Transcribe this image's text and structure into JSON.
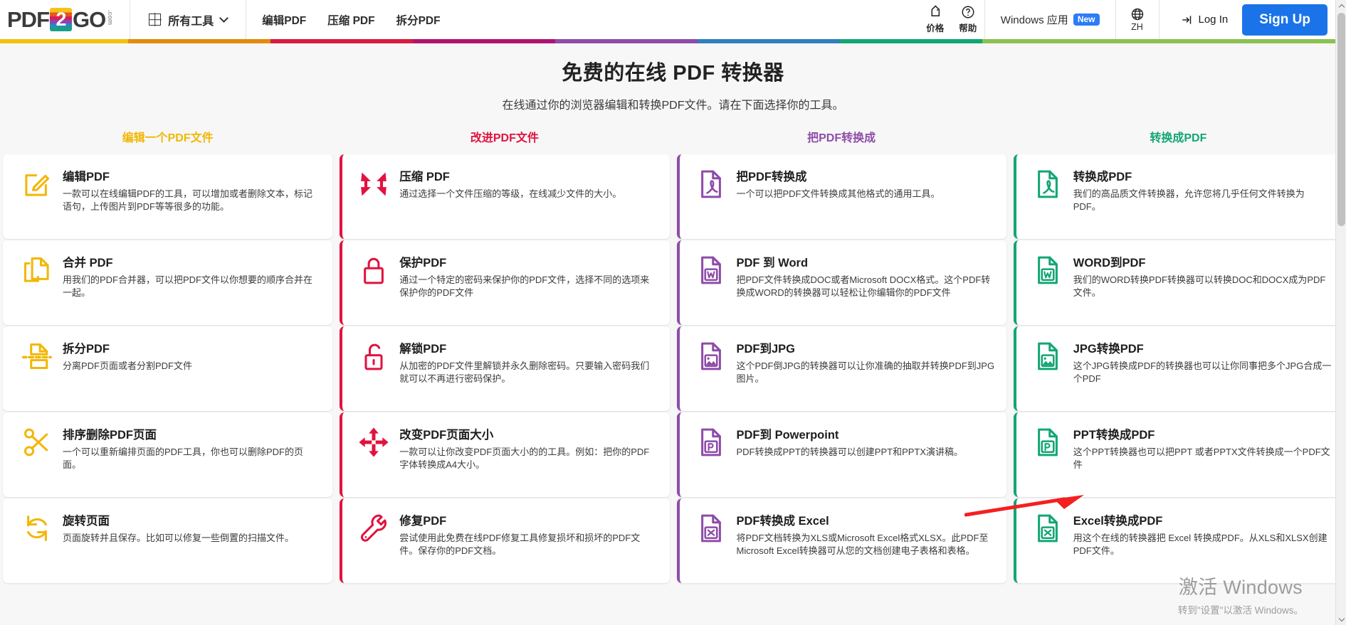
{
  "header": {
    "logo": {
      "pdf": "PDF",
      "two": "2",
      "go": "GO",
      "dotcom": ".com"
    },
    "all_tools": "所有工具",
    "nav": [
      {
        "label": "编辑PDF"
      },
      {
        "label": "压缩 PDF"
      },
      {
        "label": "拆分PDF"
      }
    ],
    "price_label": "价格",
    "help_label": "帮助",
    "windows_app": "Windows 应用",
    "new_badge": "New",
    "language": "ZH",
    "login": "Log In",
    "signup": "Sign Up"
  },
  "rainbow": [
    "#f2c10d",
    "#e28c0a",
    "#da1b3f",
    "#b01472",
    "#8e4ca8",
    "#2f7fbf",
    "#12a673",
    "#8cc152"
  ],
  "hero": {
    "title": "免费的在线 PDF 转换器",
    "subtitle": "在线通过你的浏览器编辑和转换PDF文件。请在下面选择你的工具。"
  },
  "columns": [
    {
      "heading": "编辑一个PDF文件",
      "color": "#f2b705",
      "cards": [
        {
          "icon": "edit-pdf-icon",
          "title": "编辑PDF",
          "desc": "一款可以在线编辑PDF的工具，可以增加或者删除文本，标记语句，上传图片到PDF等等很多的功能。",
          "accent": false
        },
        {
          "icon": "merge-pdf-icon",
          "title": "合并 PDF",
          "desc": "用我们的PDF合并器，可以把PDF文件以你想要的顺序合并在一起。",
          "accent": false
        },
        {
          "icon": "split-pdf-icon",
          "title": "拆分PDF",
          "desc": "分离PDF页面或者分割PDF文件",
          "accent": false
        },
        {
          "icon": "scissors-icon",
          "title": "排序删除PDF页面",
          "desc": "一个可以重新编排页面的PDF工具，你也可以删除PDF的页面。",
          "accent": false
        },
        {
          "icon": "rotate-icon",
          "title": "旋转页面",
          "desc": "页面旋转并且保存。比如可以修复一些倒置的扫描文件。",
          "accent": false
        }
      ]
    },
    {
      "heading": "改进PDF文件",
      "color": "#e1123f",
      "cards": [
        {
          "icon": "compress-icon",
          "title": "压缩 PDF",
          "desc": "通过选择一个文件压缩的等级，在线减少文件的大小。",
          "accent": true
        },
        {
          "icon": "lock-icon",
          "title": "保护PDF",
          "desc": "通过一个特定的密码来保护你的PDF文件，选择不同的选项来保护你的PDF文件",
          "accent": true
        },
        {
          "icon": "unlock-icon",
          "title": "解锁PDF",
          "desc": "从加密的PDF文件里解锁并永久删除密码。只要输入密码我们就可以不再进行密码保护。",
          "accent": true
        },
        {
          "icon": "resize-icon",
          "title": "改变PDF页面大小",
          "desc": "一款可以让你改变PDF页面大小的的工具。例如：把你的PDF字体转换成A4大小。",
          "accent": true
        },
        {
          "icon": "wrench-icon",
          "title": "修复PDF",
          "desc": "尝试使用此免费在线PDF修复工具修复损坏和损坏的PDF文件。保存你的PDF文档。",
          "accent": true
        }
      ]
    },
    {
      "heading": "把PDF转换成",
      "color": "#8e4ca8",
      "cards": [
        {
          "icon": "pdf-file-icon",
          "title": "把PDF转换成",
          "desc": "一个可以把PDF文件转换成其他格式的通用工具。",
          "accent": true
        },
        {
          "icon": "word-file-icon",
          "title": "PDF 到 Word",
          "desc": "把PDF文件转换成DOC或者Microsoft DOCX格式。这个PDF转换成WORD的转换器可以轻松让你编辑你的PDF文件",
          "accent": true
        },
        {
          "icon": "image-file-icon",
          "title": "PDF到JPG",
          "desc": "这个PDF倒JPG的转换器可以让你准确的抽取并转换PDF到JPG图片。",
          "accent": true
        },
        {
          "icon": "ppt-file-icon",
          "title": "PDF到 Powerpoint",
          "desc": "PDF转换成PPT的转换器可以创建PPT和PPTX演讲稿。",
          "accent": true
        },
        {
          "icon": "excel-file-icon",
          "title": "PDF转换成 Excel",
          "desc": "将PDF文档转换为XLS或Microsoft Excel格式XLSX。此PDF至Microsoft Excel转换器可从您的文档创建电子表格和表格。",
          "accent": true
        }
      ]
    },
    {
      "heading": "转换成PDF",
      "color": "#12a673",
      "cards": [
        {
          "icon": "pdf-file-icon",
          "title": "转换成PDF",
          "desc": "我们的高品质文件转换器，允许您将几乎任何文件转换为PDF。",
          "accent": true
        },
        {
          "icon": "word-file-icon",
          "title": "WORD到PDF",
          "desc": "我们的WORD转换PDF转换器可以转换DOC和DOCX成为PDF文件。",
          "accent": true
        },
        {
          "icon": "image-file-icon",
          "title": "JPG转换PDF",
          "desc": "这个JPG转换成PDF的转换器也可以让你同事把多个JPG合成一个PDF",
          "accent": true
        },
        {
          "icon": "ppt-file-icon",
          "title": "PPT转换成PDF",
          "desc": "这个PPT转换器也可以把PPT 或者PPTX文件转换成一个PDF文件",
          "accent": true
        },
        {
          "icon": "excel-file-icon",
          "title": "Excel转换成PDF",
          "desc": "用这个在线的转换器把 Excel 转换成PDF。从XLS和XLSX创建PDF文件。",
          "accent": true
        }
      ]
    }
  ],
  "watermark": {
    "line1": "激活 Windows",
    "line2": "转到\"设置\"以激活 Windows。"
  }
}
